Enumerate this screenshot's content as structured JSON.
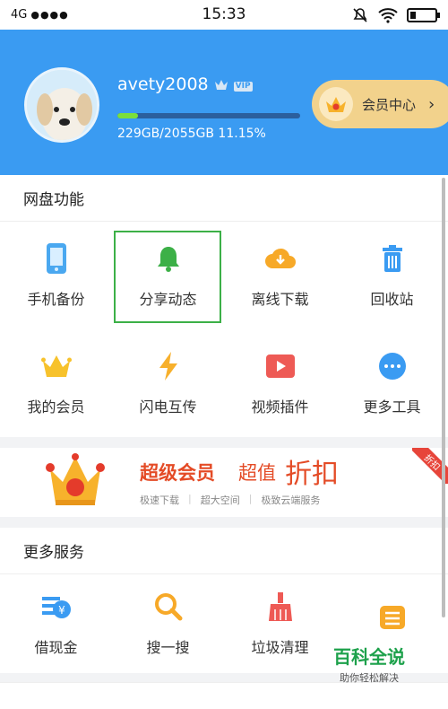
{
  "status": {
    "network": "4G",
    "signal": "●●●●",
    "time": "15:33"
  },
  "header": {
    "username": "avety2008",
    "vip_badge": "VIP",
    "storage_text": "229GB/2055GB 11.15%",
    "storage_used_fraction": 0.1115,
    "vip_center_label": "会员中心",
    "chevron": "›"
  },
  "netdisk": {
    "title": "网盘功能",
    "items": [
      {
        "label": "手机备份",
        "icon": "phone-icon"
      },
      {
        "label": "分享动态",
        "icon": "bell-icon"
      },
      {
        "label": "离线下载",
        "icon": "cloud-download-icon"
      },
      {
        "label": "回收站",
        "icon": "trash-icon"
      },
      {
        "label": "我的会员",
        "icon": "crown-icon"
      },
      {
        "label": "闪电互传",
        "icon": "lightning-icon"
      },
      {
        "label": "视频插件",
        "icon": "video-play-icon"
      },
      {
        "label": "更多工具",
        "icon": "more-dots-icon"
      }
    ]
  },
  "promo": {
    "title": "超级会员",
    "title2": "超值",
    "title3": "折扣",
    "features": [
      "极速下载",
      "超大空间",
      "极致云端服务"
    ],
    "ribbon": "折扣"
  },
  "more": {
    "title": "更多服务",
    "items": [
      {
        "label": "借现金",
        "icon": "cash-icon"
      },
      {
        "label": "搜一搜",
        "icon": "search-icon"
      },
      {
        "label": "垃圾清理",
        "icon": "broom-icon"
      },
      {
        "label": "",
        "icon": "stack-icon"
      }
    ]
  },
  "watermark": {
    "line1": "百科全说",
    "line2": "助你轻松解决"
  },
  "colors": {
    "primary": "#3a9bf2",
    "accent_green": "#3cb047",
    "promo_red": "#e44b26"
  }
}
